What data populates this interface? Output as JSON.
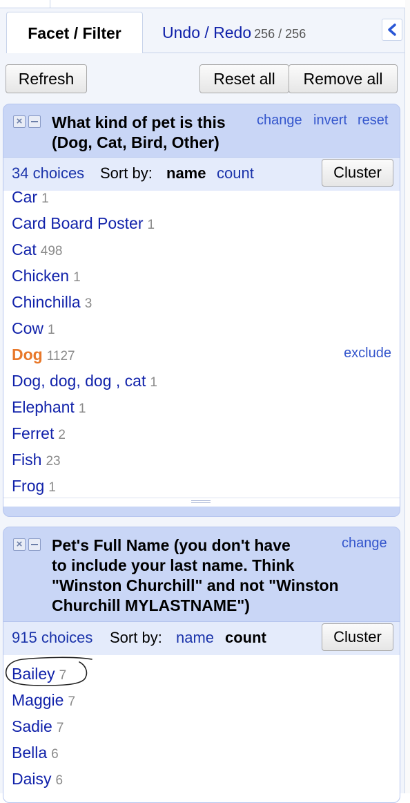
{
  "tabs": {
    "facet_filter": "Facet / Filter",
    "undo_redo": "Undo / Redo",
    "undo_count": "256 / 256"
  },
  "toolbar": {
    "refresh": "Refresh",
    "reset_all": "Reset all",
    "remove_all": "Remove all"
  },
  "facet1": {
    "title_line1": "What kind of pet is this",
    "title_line2": "(Dog, Cat, Bird, Other)",
    "links": {
      "change": "change",
      "invert": "invert",
      "reset": "reset"
    },
    "choices_count": "34 choices",
    "sort_by": "Sort by:",
    "sort_name": "name",
    "sort_count": "count",
    "sort_active": "name",
    "cluster": "Cluster",
    "exclude": "exclude",
    "items": [
      {
        "name": "Car",
        "count": "1"
      },
      {
        "name": "Card Board Poster",
        "count": "1"
      },
      {
        "name": "Cat",
        "count": "498"
      },
      {
        "name": "Chicken",
        "count": "1"
      },
      {
        "name": "Chinchilla",
        "count": "3"
      },
      {
        "name": "Cow",
        "count": "1"
      },
      {
        "name": "Dog",
        "count": "1127",
        "selected": true
      },
      {
        "name": "Dog, dog, dog , cat",
        "count": "1"
      },
      {
        "name": "Elephant",
        "count": "1"
      },
      {
        "name": "Ferret",
        "count": "2"
      },
      {
        "name": "Fish",
        "count": "23"
      },
      {
        "name": "Frog",
        "count": "1"
      }
    ]
  },
  "facet2": {
    "title_lines": [
      "Pet's Full Name (you don't have",
      "to include your last name. Think",
      "\"Winston Churchill\" and not \"Winston",
      "Churchill MYLASTNAME\")"
    ],
    "links": {
      "change": "change"
    },
    "choices_count": "915 choices",
    "sort_by": "Sort by:",
    "sort_name": "name",
    "sort_count": "count",
    "sort_active": "count",
    "cluster": "Cluster",
    "items": [
      {
        "name": "Bailey",
        "count": "7",
        "circled": true
      },
      {
        "name": "Maggie",
        "count": "7"
      },
      {
        "name": "Sadie",
        "count": "7"
      },
      {
        "name": "Bella",
        "count": "6"
      },
      {
        "name": "Daisy",
        "count": "6"
      }
    ]
  },
  "colors": {
    "link": "#1122aa",
    "selected": "#e8782a",
    "facet_header": "#c9d6f6",
    "count_gray": "#8a8a8a"
  },
  "icons": [
    "collapse-left-icon",
    "close-facet-icon",
    "minimize-facet-icon",
    "resize-grip-icon"
  ]
}
